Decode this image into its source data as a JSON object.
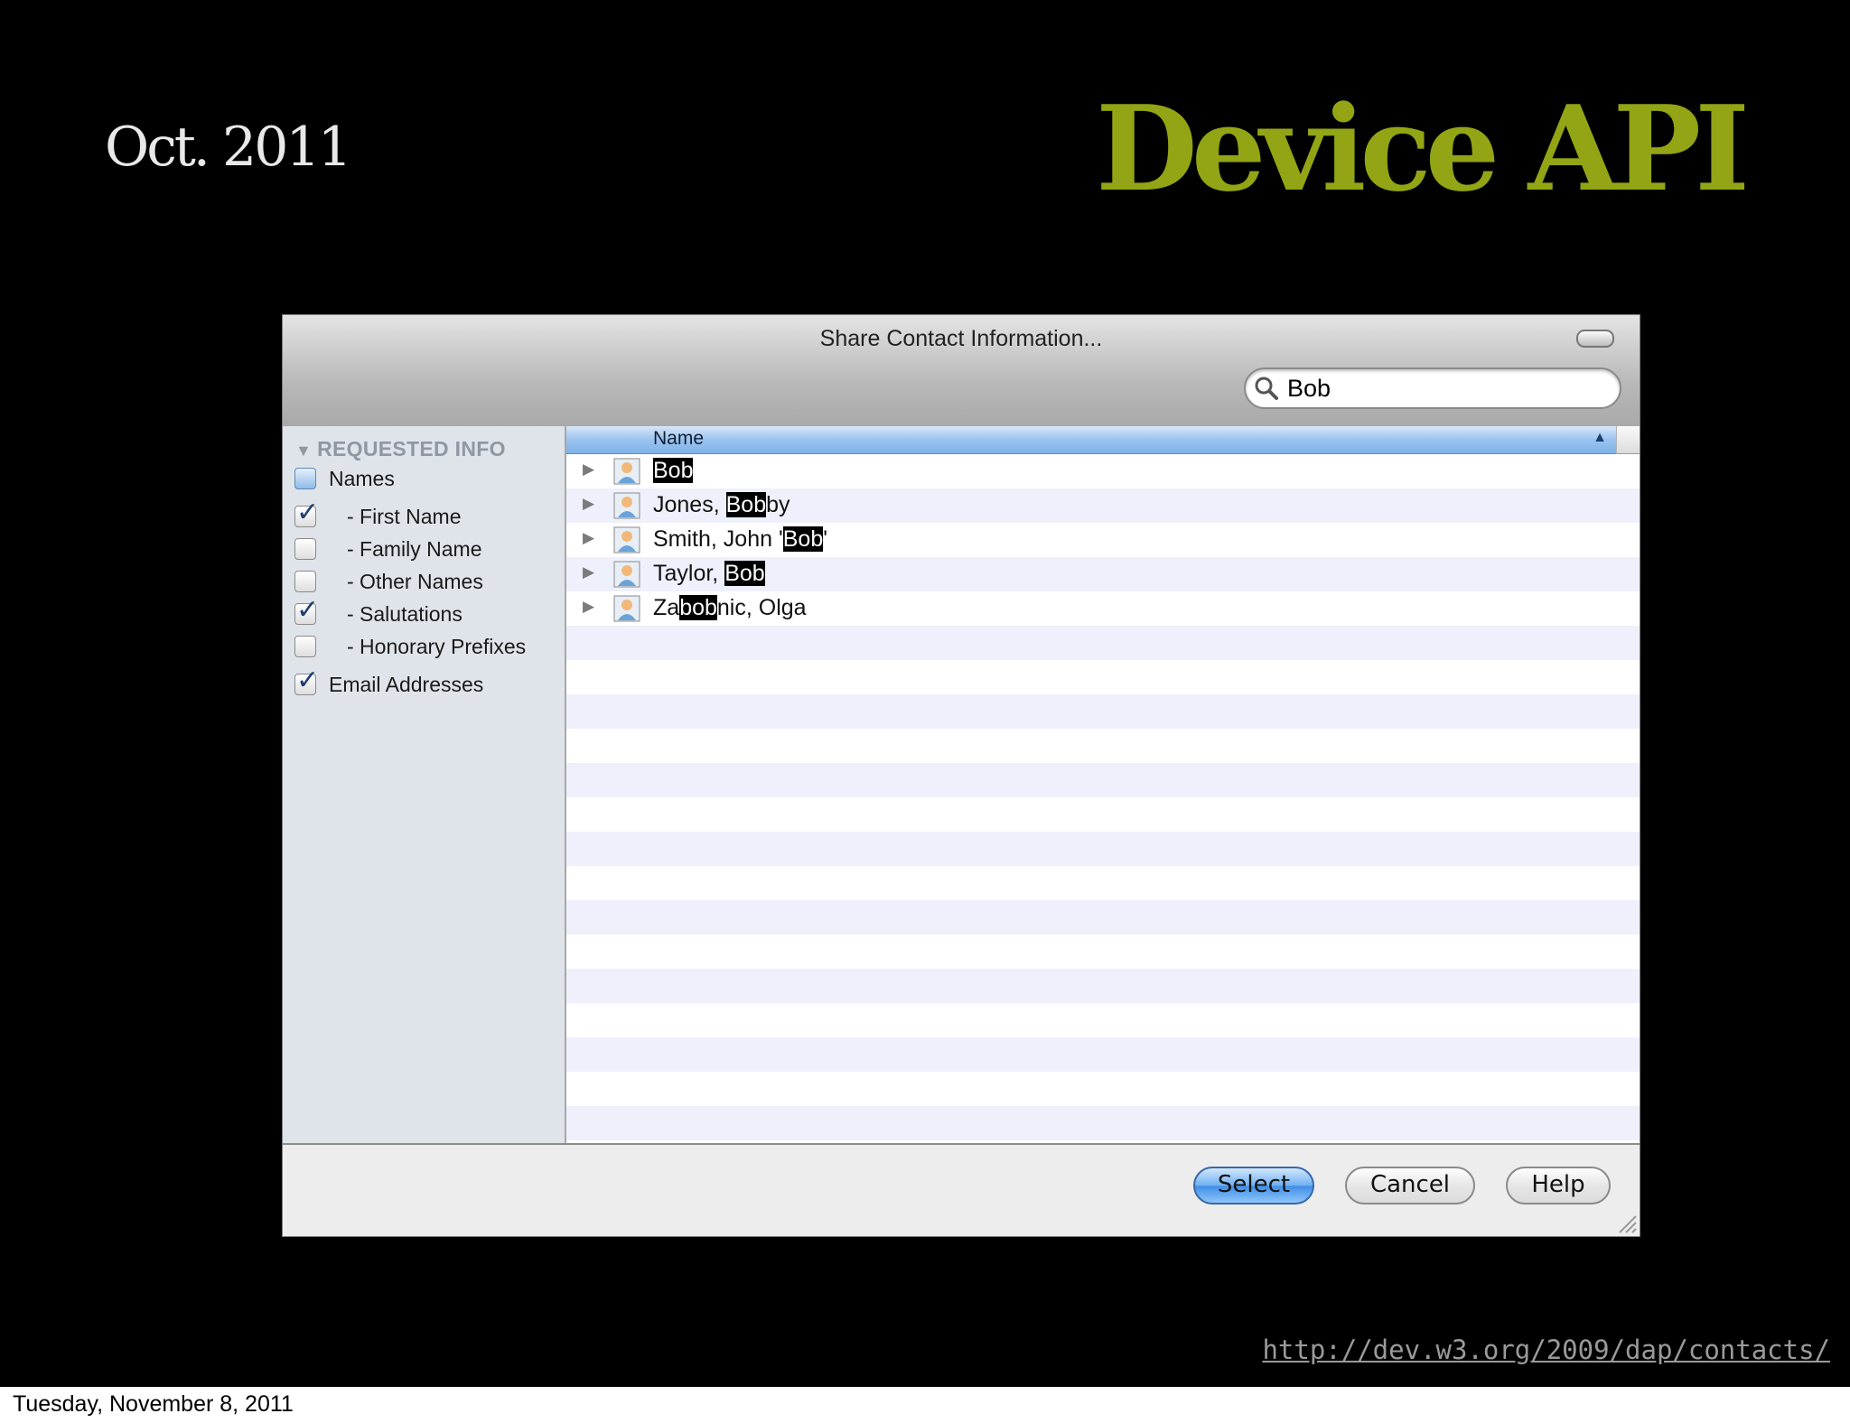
{
  "slide": {
    "date_label": "Oct. 2011",
    "title": "Device API",
    "link": "http://dev.w3.org/2009/dap/contacts/",
    "footer_date": "Tuesday, November 8, 2011",
    "title_color": "#93a414"
  },
  "dialog": {
    "title": "Share Contact Information...",
    "search": {
      "value": "Bob",
      "icon": "magnifier-icon"
    },
    "sidebar": {
      "header": "REQUESTED INFO",
      "items": [
        {
          "label": "Names",
          "checked": "mixed"
        },
        {
          "label": "- First Name",
          "checked": true
        },
        {
          "label": "- Family Name",
          "checked": false
        },
        {
          "label": "- Other Names",
          "checked": false
        },
        {
          "label": "- Salutations",
          "checked": true
        },
        {
          "label": "- Honorary Prefixes",
          "checked": false
        },
        {
          "label": "Email Addresses",
          "checked": true
        }
      ]
    },
    "list": {
      "column_header": "Name",
      "sort_indicator": "▲",
      "rows": [
        {
          "parts": [
            "",
            "Bob",
            ""
          ]
        },
        {
          "parts": [
            "Jones, ",
            "Bob",
            "by"
          ]
        },
        {
          "parts": [
            "Smith, John '",
            "Bob",
            "'"
          ]
        },
        {
          "parts": [
            "Taylor, ",
            "Bob",
            ""
          ]
        },
        {
          "parts": [
            "Za",
            "bob",
            "nic, Olga"
          ]
        }
      ]
    },
    "buttons": {
      "select": "Select",
      "cancel": "Cancel",
      "help": "Help"
    }
  }
}
